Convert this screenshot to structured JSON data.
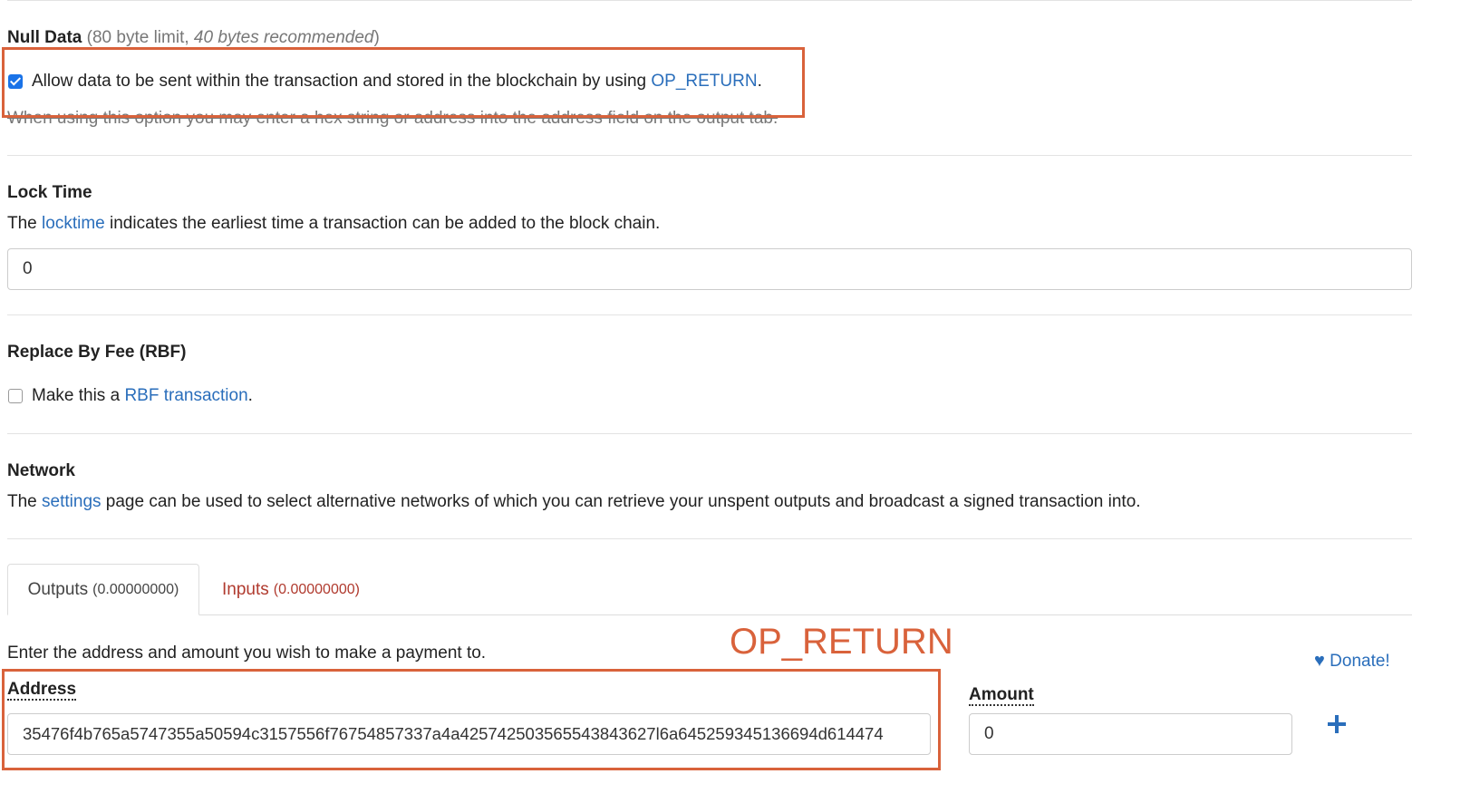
{
  "null_data": {
    "title": "Null Data",
    "limit_prefix": "(80 byte limit, ",
    "limit_italic": "40 bytes recommended",
    "limit_suffix": ")",
    "checkbox_text": "Allow data to be sent within the transaction and stored in the blockchain by using",
    "checkbox_link": "OP_RETURN",
    "checkbox_checked": true,
    "help_text": "When using this option you may enter a hex string or address into the address field on the output tab."
  },
  "lock_time": {
    "title": "Lock Time",
    "desc_prefix": "The",
    "desc_link": "locktime",
    "desc_suffix": "indicates the earliest time a transaction can be added to the block chain.",
    "value": "0"
  },
  "rbf": {
    "title": "Replace By Fee (RBF)",
    "checkbox_text": "Make this a",
    "checkbox_link": "RBF transaction",
    "checkbox_checked": false
  },
  "network": {
    "title": "Network",
    "desc_prefix": "The",
    "desc_link": "settings",
    "desc_suffix": "page can be used to select alternative networks of which you can retrieve your unspent outputs and broadcast a signed transaction into."
  },
  "tabs": [
    {
      "label": "Outputs",
      "amount": "(0.00000000)",
      "active": true
    },
    {
      "label": "Inputs",
      "amount": "(0.00000000)",
      "active": false
    }
  ],
  "outputs": {
    "instruction": "Enter the address and amount you wish to make a payment to.",
    "annotation": "OP_RETURN",
    "donate_label": "Donate!",
    "address_label": "Address",
    "address_value": "35476f4b765a5747355a50594c3157556f76754857337a4a425742503565543843627l6a645259345136694d614474",
    "amount_label": "Amount",
    "amount_value": "0",
    "add_icon": "plus-icon"
  },
  "colors": {
    "link": "#2a6ebb",
    "annotation": "#d9623b",
    "inputs_tab": "#b03a2e",
    "checkbox": "#1a73e8"
  }
}
